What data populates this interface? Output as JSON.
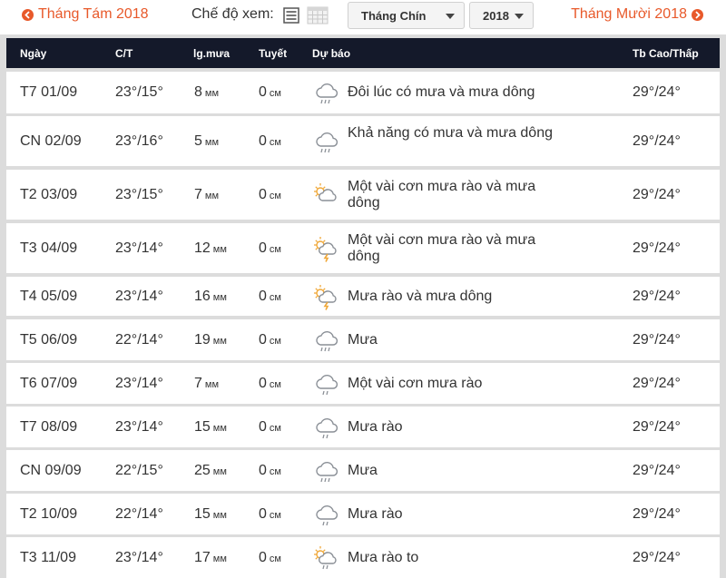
{
  "toolbar": {
    "prev_month": "Tháng Tám 2018",
    "next_month": "Tháng Mười 2018",
    "view_mode_label": "Chế độ xem:",
    "month_select": "Tháng Chín",
    "year_select": "2018"
  },
  "table": {
    "headers": [
      "Ngày",
      "C/T",
      "lg.mưa",
      "Tuyết",
      "Dự báo",
      "Tb Cao/Thấp"
    ],
    "rows": [
      {
        "day": "T7 01/09",
        "ct": "23°/15°",
        "rain": "8",
        "rain_unit": "мм",
        "snow": "0",
        "snow_unit": "см",
        "forecast": "Đôi lúc có mưa và mưa dông",
        "avg": "29°/24°",
        "icon": "cloud-rain-icon"
      },
      {
        "day": "CN 02/09",
        "ct": "23°/16°",
        "rain": "5",
        "rain_unit": "мм",
        "snow": "0",
        "snow_unit": "см",
        "forecast": "Khả năng có mưa và mưa dông",
        "avg": "29°/24°",
        "icon": "cloud-rain-icon"
      },
      {
        "day": "T2 03/09",
        "ct": "23°/15°",
        "rain": "7",
        "rain_unit": "мм",
        "snow": "0",
        "snow_unit": "см",
        "forecast": "Một vài cơn mưa rào và mưa dông",
        "avg": "29°/24°",
        "icon": "sun-cloud-icon"
      },
      {
        "day": "T3 04/09",
        "ct": "23°/14°",
        "rain": "12",
        "rain_unit": "мм",
        "snow": "0",
        "snow_unit": "см",
        "forecast": "Một vài cơn mưa rào và mưa dông",
        "avg": "29°/24°",
        "icon": "sun-cloud-thunder-icon"
      },
      {
        "day": "T4 05/09",
        "ct": "23°/14°",
        "rain": "16",
        "rain_unit": "мм",
        "snow": "0",
        "snow_unit": "см",
        "forecast": "Mưa rào và mưa dông",
        "avg": "29°/24°",
        "icon": "sun-cloud-thunder-icon"
      },
      {
        "day": "T5 06/09",
        "ct": "22°/14°",
        "rain": "19",
        "rain_unit": "мм",
        "snow": "0",
        "snow_unit": "см",
        "forecast": "Mưa",
        "avg": "29°/24°",
        "icon": "cloud-rain-icon"
      },
      {
        "day": "T6 07/09",
        "ct": "23°/14°",
        "rain": "7",
        "rain_unit": "мм",
        "snow": "0",
        "snow_unit": "см",
        "forecast": "Một vài cơn mưa rào",
        "avg": "29°/24°",
        "icon": "cloud-shower-icon"
      },
      {
        "day": "T7 08/09",
        "ct": "23°/14°",
        "rain": "15",
        "rain_unit": "мм",
        "snow": "0",
        "snow_unit": "см",
        "forecast": "Mưa rào",
        "avg": "29°/24°",
        "icon": "cloud-shower-icon"
      },
      {
        "day": "CN 09/09",
        "ct": "22°/15°",
        "rain": "25",
        "rain_unit": "мм",
        "snow": "0",
        "snow_unit": "см",
        "forecast": "Mưa",
        "avg": "29°/24°",
        "icon": "cloud-rain-icon"
      },
      {
        "day": "T2 10/09",
        "ct": "22°/14°",
        "rain": "15",
        "rain_unit": "мм",
        "snow": "0",
        "snow_unit": "см",
        "forecast": "Mưa rào",
        "avg": "29°/24°",
        "icon": "cloud-shower-icon"
      },
      {
        "day": "T3 11/09",
        "ct": "23°/14°",
        "rain": "17",
        "rain_unit": "мм",
        "snow": "0",
        "snow_unit": "см",
        "forecast": "Mưa rào to",
        "avg": "29°/24°",
        "icon": "sun-cloud-rain-icon"
      }
    ]
  },
  "colors": {
    "accent": "#e8592a",
    "header_bg": "#14192a",
    "row_bg": "#ffffff",
    "page_bg": "#dcdcdc",
    "icon_gray": "#8a8f96",
    "icon_sun": "#f0a838"
  }
}
